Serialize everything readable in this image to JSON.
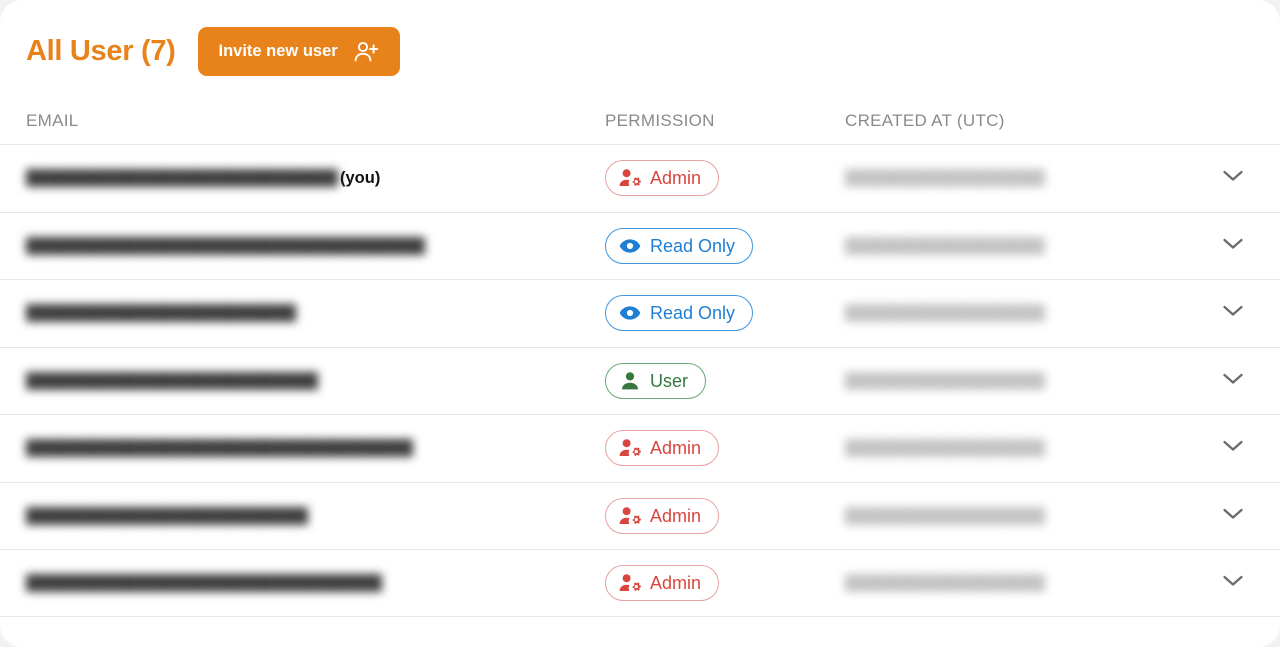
{
  "header": {
    "title": "All User (7)",
    "invite_button_label": "Invite new user",
    "invite_button_icon": "person-plus-icon",
    "accent_color": "#e8821b"
  },
  "table": {
    "columns": [
      "EMAIL",
      "PERMISSION",
      "CREATED AT (UTC)"
    ],
    "row_action_icon": "chevron-down-icon",
    "rows": [
      {
        "email_redacted": "██████████████████████████████",
        "email_width": 312,
        "you_label": "(you)",
        "is_you": true,
        "permission": "Admin",
        "permission_icon": "person-gear-icon",
        "permission_color": "#d9453f",
        "created_redacted": "████████████████████",
        "created_width": 200
      },
      {
        "email_redacted": "███████████████████████████████████████",
        "email_width": 399,
        "you_label": "",
        "is_you": false,
        "permission": "Read Only",
        "permission_icon": "eye-icon",
        "permission_color": "#1f7fd4",
        "created_redacted": "████████████████████",
        "created_width": 200
      },
      {
        "email_redacted": "█████████████████████████",
        "email_width": 270,
        "you_label": "",
        "is_you": false,
        "permission": "Read Only",
        "permission_icon": "eye-icon",
        "permission_color": "#1f7fd4",
        "created_redacted": "████████████████████",
        "created_width": 200
      },
      {
        "email_redacted": "███████████████████████████",
        "email_width": 292,
        "you_label": "",
        "is_you": false,
        "permission": "User",
        "permission_icon": "person-icon",
        "permission_color": "#37783f",
        "created_redacted": "████████████████████",
        "created_width": 200
      },
      {
        "email_redacted": "██████████████████████████████████████",
        "email_width": 387,
        "you_label": "",
        "is_you": false,
        "permission": "Admin",
        "permission_icon": "person-gear-icon",
        "permission_color": "#d9453f",
        "created_redacted": "████████████████████",
        "created_width": 200
      },
      {
        "email_redacted": "██████████████████████████",
        "email_width": 282,
        "you_label": "",
        "is_you": false,
        "permission": "Admin",
        "permission_icon": "person-gear-icon",
        "permission_color": "#d9453f",
        "created_redacted": "████████████████████",
        "created_width": 200
      },
      {
        "email_redacted": "█████████████████████████████████",
        "email_width": 356,
        "you_label": "",
        "is_you": false,
        "permission": "Admin",
        "permission_icon": "person-gear-icon",
        "permission_color": "#d9453f",
        "created_redacted": "████████████████████",
        "created_width": 200
      }
    ]
  }
}
